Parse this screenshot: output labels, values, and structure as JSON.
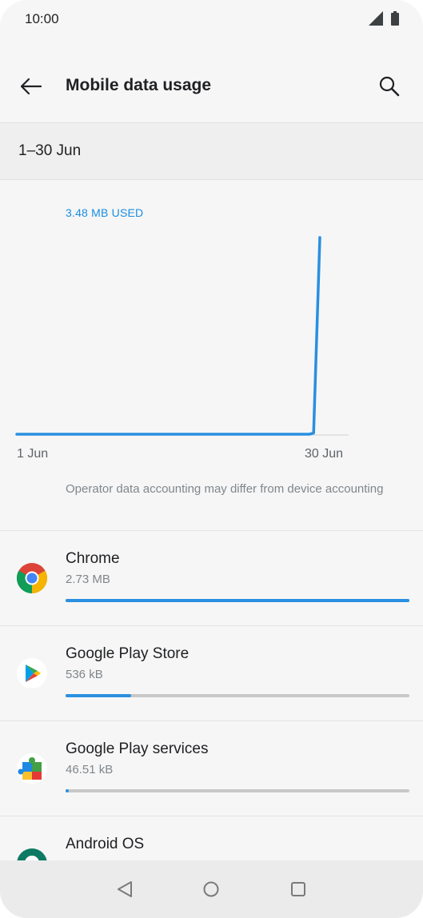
{
  "status_bar": {
    "time": "10:00"
  },
  "app_bar": {
    "title": "Mobile data usage"
  },
  "cycle": {
    "label": "1–30 Jun"
  },
  "usage": {
    "amount_label": "3.48 MB USED"
  },
  "chart_data": {
    "type": "line",
    "x_start_label": "1 Jun",
    "x_end_label": "30 Jun",
    "x": [
      1,
      29,
      29.4,
      30
    ],
    "y": [
      0,
      0,
      0.02,
      3.48
    ],
    "color": "#2a8fe0"
  },
  "note": "Operator data accounting may differ from device accounting",
  "apps": [
    {
      "name": "Chrome",
      "size": "2.73 MB",
      "fraction": 1.0
    },
    {
      "name": "Google Play Store",
      "size": "536 kB",
      "fraction": 0.19
    },
    {
      "name": "Google Play services",
      "size": "46.51 kB",
      "fraction": 0.01
    },
    {
      "name": "Android OS",
      "size": "",
      "fraction": 0.0
    }
  ],
  "colors": {
    "accent": "#2a8fe0",
    "track": "#c8c8c8"
  }
}
